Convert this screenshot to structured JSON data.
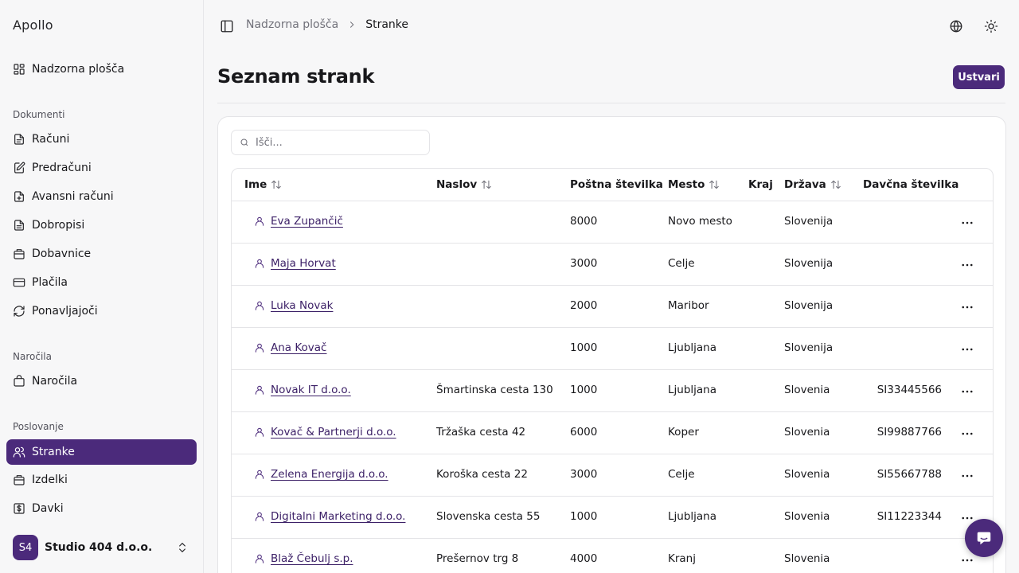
{
  "app": {
    "brand": "Apollo"
  },
  "sidebar": {
    "dashboard": {
      "label": "Nadzorna plošča",
      "icon": "dashboard-icon"
    },
    "groups": [
      {
        "label": "Dokumenti",
        "items": [
          {
            "label": "Računi",
            "icon": "file-icon"
          },
          {
            "label": "Predračuni",
            "icon": "file-edit-icon"
          },
          {
            "label": "Avansni računi",
            "icon": "file-plus-icon"
          },
          {
            "label": "Dobropisi",
            "icon": "file-text-icon"
          },
          {
            "label": "Dobavnice",
            "icon": "package-icon"
          },
          {
            "label": "Plačila",
            "icon": "credit-card-icon"
          },
          {
            "label": "Ponavljajoči",
            "icon": "refresh-icon"
          }
        ]
      },
      {
        "label": "Naročila",
        "items": [
          {
            "label": "Naročila",
            "icon": "shopping-bag-icon"
          }
        ]
      },
      {
        "label": "Poslovanje",
        "items": [
          {
            "label": "Stranke",
            "icon": "users-icon",
            "active": true
          },
          {
            "label": "Izdelki",
            "icon": "package-icon"
          },
          {
            "label": "Davki",
            "icon": "dollar-icon"
          }
        ]
      }
    ],
    "org": {
      "initials": "S4",
      "name": "Studio 404 d.o.o."
    }
  },
  "header": {
    "breadcrumb": [
      "Nadzorna plošča",
      "Stranke"
    ]
  },
  "main": {
    "title": "Seznam strank",
    "create_label": "Ustvari",
    "search": {
      "placeholder": "Išči...",
      "value": ""
    },
    "table": {
      "columns": [
        "Ime",
        "Naslov",
        "Poštna številka",
        "Mesto",
        "Kraj",
        "Država",
        "Davčna številka"
      ],
      "rows": [
        {
          "name": "Eva Zupančič",
          "address": "",
          "postal": "8000",
          "city": "Novo mesto",
          "place": "",
          "country": "Slovenija",
          "tax": ""
        },
        {
          "name": "Maja Horvat",
          "address": "",
          "postal": "3000",
          "city": "Celje",
          "place": "",
          "country": "Slovenija",
          "tax": ""
        },
        {
          "name": "Luka Novak",
          "address": "",
          "postal": "2000",
          "city": "Maribor",
          "place": "",
          "country": "Slovenija",
          "tax": ""
        },
        {
          "name": "Ana Kovač",
          "address": "",
          "postal": "1000",
          "city": "Ljubljana",
          "place": "",
          "country": "Slovenija",
          "tax": ""
        },
        {
          "name": "Novak IT d.o.o.",
          "address": "Šmartinska cesta 130",
          "postal": "1000",
          "city": "Ljubljana",
          "place": "",
          "country": "Slovenia",
          "tax": "SI33445566"
        },
        {
          "name": "Kovač & Partnerji d.o.o.",
          "address": "Tržaška cesta 42",
          "postal": "6000",
          "city": "Koper",
          "place": "",
          "country": "Slovenia",
          "tax": "SI99887766"
        },
        {
          "name": "Zelena Energija d.o.o.",
          "address": "Koroška cesta 22",
          "postal": "3000",
          "city": "Celje",
          "place": "",
          "country": "Slovenia",
          "tax": "SI55667788"
        },
        {
          "name": "Digitalni Marketing d.o.o.",
          "address": "Slovenska cesta 55",
          "postal": "1000",
          "city": "Ljubljana",
          "place": "",
          "country": "Slovenia",
          "tax": "SI11223344"
        },
        {
          "name": "Blaž Čebulj s.p.",
          "address": "Prešernov trg 8",
          "postal": "4000",
          "city": "Kranj",
          "place": "",
          "country": "Slovenia",
          "tax": ""
        }
      ]
    }
  },
  "colors": {
    "accent": "#4b2a7b",
    "link": "#3b1f66",
    "border": "#e4e4e7",
    "background": "#f7f7f8"
  }
}
